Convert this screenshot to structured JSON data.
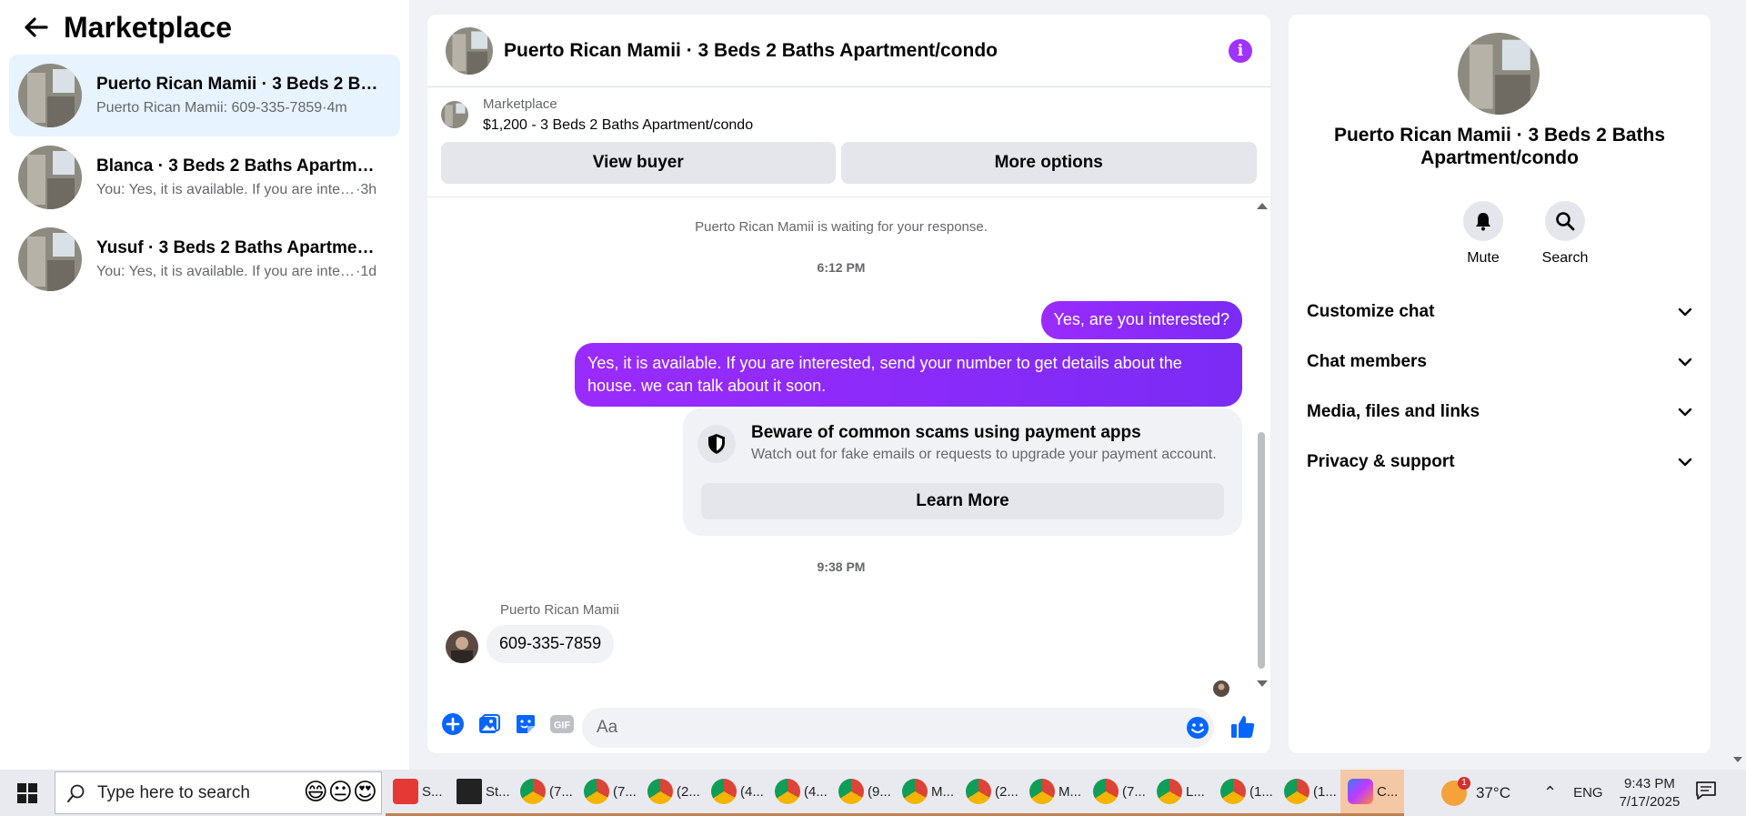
{
  "sidebar": {
    "title": "Marketplace",
    "conversations": [
      {
        "name": "Puerto Rican Mamii · 3 Beds 2 Bat...",
        "preview": "Puerto Rican Mamii: 609-335-7859",
        "time": "·4m"
      },
      {
        "name": "Blanca · 3 Beds 2 Baths Apartment...",
        "preview": "You: Yes, it is available. If you are inter...",
        "time": "·3h"
      },
      {
        "name": "Yusuf · 3 Beds 2 Baths Apartment/...",
        "preview": "You: Yes, it is available. If you are inter...",
        "time": "·1d"
      }
    ]
  },
  "chat": {
    "title": "Puerto Rican Mamii · 3 Beds 2 Baths Apartment/condo",
    "listing": {
      "source": "Marketplace",
      "price_title": "$1,200 - 3 Beds 2 Baths Apartment/condo"
    },
    "view_buyer": "View buyer",
    "more_options": "More options",
    "waiting_note": "Puerto Rican Mamii is waiting for your response.",
    "time1": "6:12 PM",
    "msg_out_1": "Yes, are you interested?",
    "msg_out_2": "Yes, it is available. If you are interested, send your number to get details about the house. we can talk about it soon.",
    "scam": {
      "title": "Beware of common scams using payment apps",
      "text": "Watch out for fake emails or requests to upgrade your payment account.",
      "button": "Learn More"
    },
    "time2": "9:38 PM",
    "sender": "Puerto Rican Mamii",
    "msg_in_1": "609-335-7859",
    "composer_placeholder": "Aa"
  },
  "right_panel": {
    "title": "Puerto Rican Mamii · 3 Beds 2 Baths Apartment/condo",
    "mute": "Mute",
    "search": "Search",
    "sections": [
      "Customize chat",
      "Chat members",
      "Media, files and links",
      "Privacy & support"
    ]
  },
  "taskbar": {
    "search_placeholder": "Type here to search",
    "apps": [
      "S...",
      "St...",
      "(7...",
      "(7...",
      "(2...",
      "(4...",
      "(4...",
      "(9...",
      "M...",
      "(2...",
      "M...",
      "(7...",
      "L...",
      "(1...",
      "(1...",
      "C..."
    ],
    "weather": "37°C",
    "weather_badge": "1",
    "lang": "ENG",
    "time": "9:43 PM",
    "date": "7/17/2025"
  },
  "colors": {
    "accent": "#a033ff",
    "bubble": "#8a2bfc",
    "link_blue": "#0866ff"
  }
}
